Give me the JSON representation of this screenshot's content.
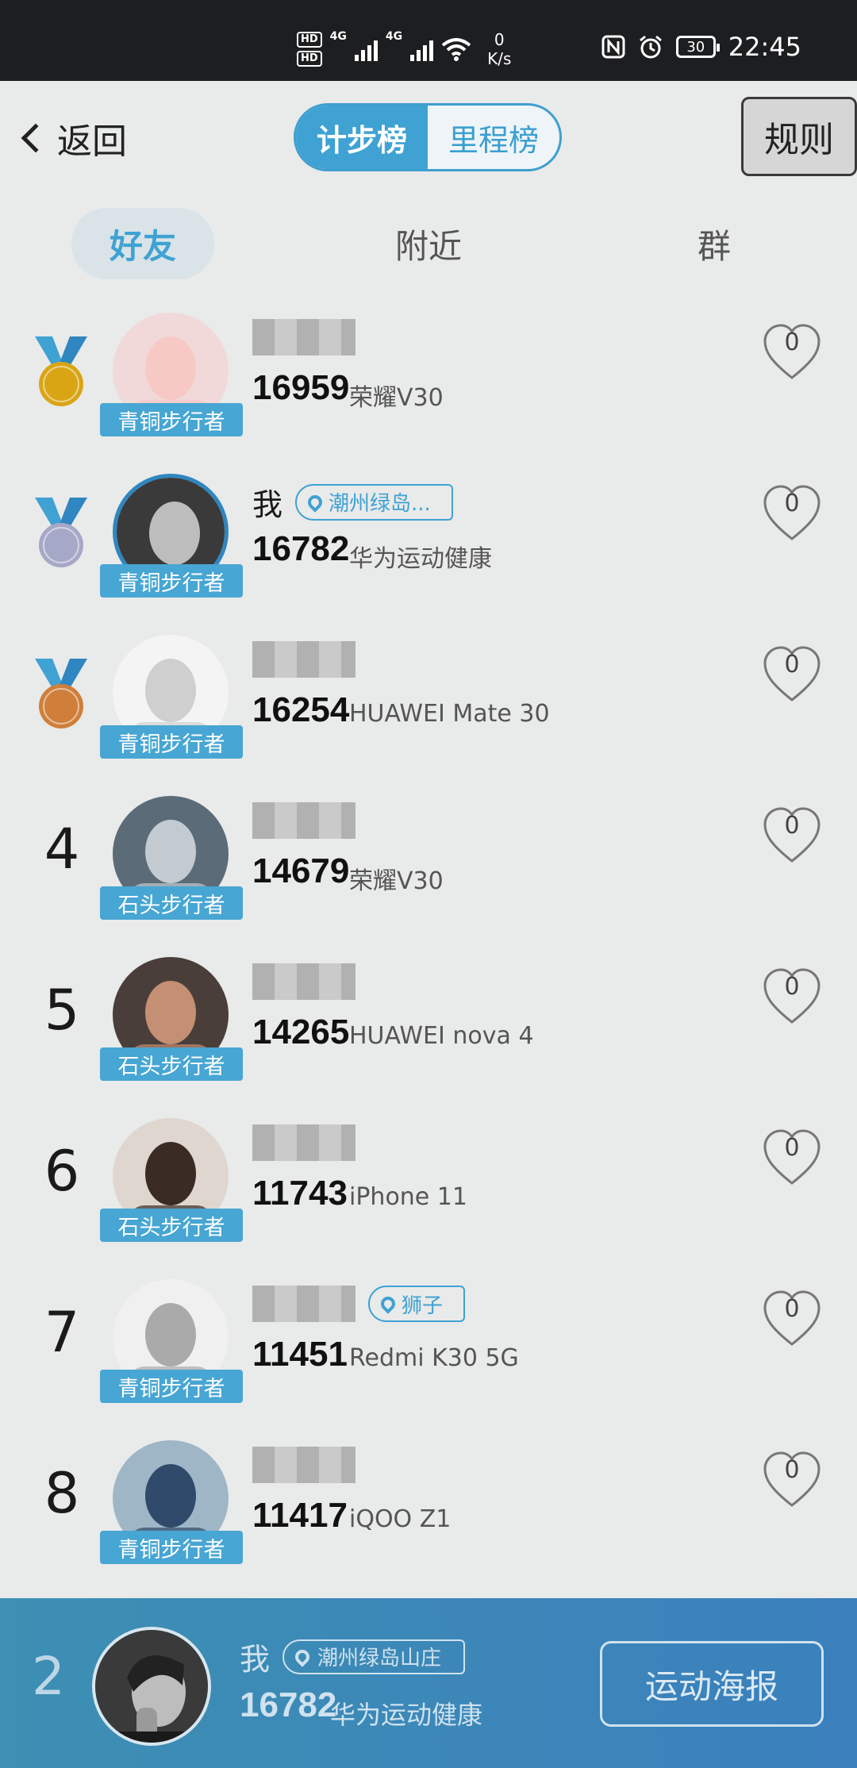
{
  "status_bar": {
    "hd1": "HD",
    "hd1_sub": "1",
    "hd2": "HD",
    "hd2_sub": "2",
    "net1": "4G",
    "net2": "4G",
    "speed_value": "0",
    "speed_unit": "K/s",
    "battery": "30",
    "time": "22:45"
  },
  "header": {
    "back_label": "返回",
    "seg_tabs": [
      "计步榜",
      "里程榜"
    ],
    "active_seg": "计步榜",
    "rules_label": "规则"
  },
  "tabs": {
    "items": [
      "好友",
      "附近",
      "群"
    ],
    "active": "好友"
  },
  "rows": [
    {
      "rank": "1",
      "medal": "gold",
      "level": "青铜步行者",
      "name": "",
      "steps": "16959",
      "device": "荣耀V30",
      "likes": "0",
      "loc_tag": ""
    },
    {
      "rank": "2",
      "medal": "silver",
      "level": "青铜步行者",
      "name": "我",
      "steps": "16782",
      "device": "华为运动健康",
      "likes": "0",
      "loc_tag": "潮州绿岛..."
    },
    {
      "rank": "3",
      "medal": "bronze",
      "level": "青铜步行者",
      "name": "",
      "steps": "16254",
      "device": "HUAWEI Mate 30",
      "likes": "0",
      "loc_tag": ""
    },
    {
      "rank": "4",
      "medal": "",
      "level": "石头步行者",
      "name": "",
      "steps": "14679",
      "device": "荣耀V30",
      "likes": "0",
      "loc_tag": ""
    },
    {
      "rank": "5",
      "medal": "",
      "level": "石头步行者",
      "name": "",
      "steps": "14265",
      "device": "HUAWEI nova 4",
      "likes": "0",
      "loc_tag": ""
    },
    {
      "rank": "6",
      "medal": "",
      "level": "石头步行者",
      "name": "",
      "steps": "11743",
      "device": "iPhone 11",
      "likes": "0",
      "loc_tag": ""
    },
    {
      "rank": "7",
      "medal": "",
      "level": "青铜步行者",
      "name": "",
      "steps": "11451",
      "device": "Redmi K30 5G",
      "likes": "0",
      "loc_tag": "狮子"
    },
    {
      "rank": "8",
      "medal": "",
      "level": "青铜步行者",
      "name": "",
      "steps": "11417",
      "device": "iQOO Z1",
      "likes": "0",
      "loc_tag": ""
    }
  ],
  "me": {
    "rank": "2",
    "name": "我",
    "location": "潮州绿岛山庄",
    "steps": "16782",
    "device": "华为运动健康",
    "poster_label": "运动海报"
  },
  "colors": {
    "accent": "#3fa2d3",
    "bottom_bar": "#3b80bd",
    "gold": "#d9a514",
    "silver": "#a6a8c7",
    "bronze": "#cf7f3a"
  }
}
